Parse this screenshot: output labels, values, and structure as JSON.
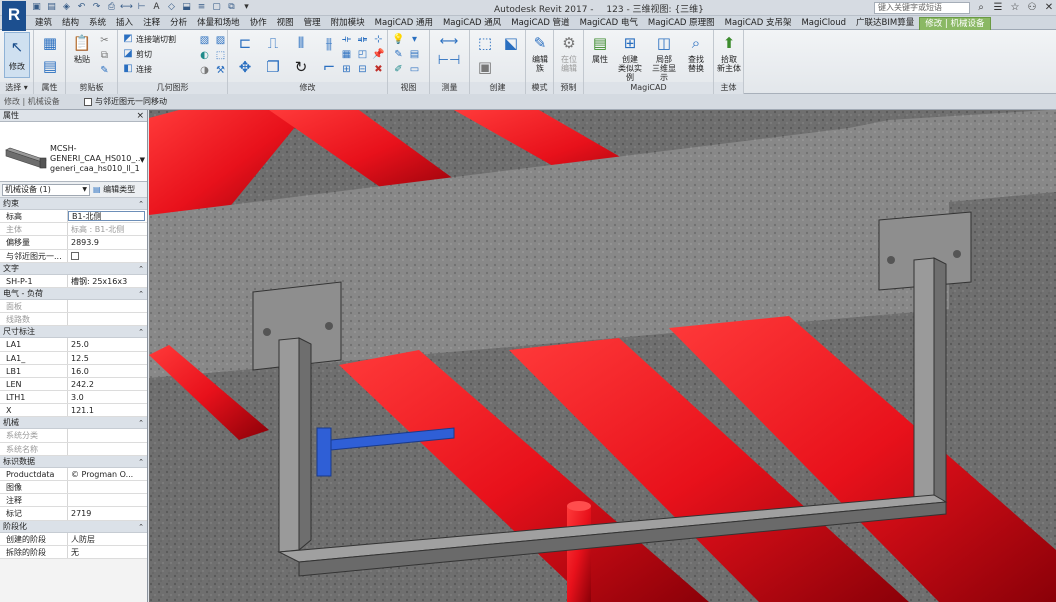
{
  "titlebar": {
    "app_name": "Autodesk Revit 2017 -",
    "document": "123 - 三维视图: {三维}",
    "search_placeholder": "键入关键字或短语"
  },
  "tabs": [
    "建筑",
    "结构",
    "系统",
    "插入",
    "注释",
    "分析",
    "体量和场地",
    "协作",
    "视图",
    "管理",
    "附加模块",
    "MagiCAD 通用",
    "MagiCAD 通风",
    "MagiCAD 管道",
    "MagiCAD 电气",
    "MagiCAD 原理图",
    "MagiCAD 支吊架",
    "MagiCloud",
    "广联达BIM算量",
    "修改 | 机械设备"
  ],
  "active_tab_index": 19,
  "ribbon": {
    "modify_label": "修改",
    "clipboard": {
      "paste": "粘贴"
    },
    "geometry": {
      "cut": "连接端切割",
      "cut2": "剪切",
      "join": "连接"
    },
    "big_buttons": [
      {
        "label": "编辑\n族",
        "name": "edit-family"
      },
      {
        "label": "在位\n编辑",
        "name": "edit-in-place"
      },
      {
        "label": "属性",
        "name": "magicad-properties"
      },
      {
        "label": "创建\n类似实例",
        "name": "create-similar"
      },
      {
        "label": "局部\n三维显示",
        "name": "local-3d"
      },
      {
        "label": "查找\n替换",
        "name": "find-replace"
      },
      {
        "label": "拾取\n新主体",
        "name": "pick-new-host"
      }
    ],
    "panel_labels": {
      "select": "选择 ▾",
      "properties": "属性",
      "clipboard": "剪贴板",
      "geometry": "几何图形",
      "modify": "修改",
      "view": "视图",
      "measure": "测量",
      "create": "创建",
      "mode": "模式",
      "preset": "预制",
      "magicad": "MagiCAD",
      "host": "主体"
    }
  },
  "options_bar": {
    "label": "修改 | 机械设备",
    "checkbox_label": "与邻近图元一同移动"
  },
  "properties_palette": {
    "title": "属性",
    "type_name_line1": "MCSH-",
    "type_name_line2": "GENERI_CAA_HS010_...",
    "type_name_line3": "generi_caa_hs010_ll_1",
    "instance_selector": "机械设备 (1)",
    "edit_type": "编辑类型",
    "sections": [
      {
        "title": "约束",
        "rows": [
          {
            "name": "标高",
            "value": "B1-北侧",
            "boxed": true
          },
          {
            "name": "主体",
            "value": "标高 : B1-北侧",
            "dim": true
          },
          {
            "name": "偏移量",
            "value": "2893.9"
          },
          {
            "name": "与邻近图元一...",
            "value": "",
            "checkbox": true
          }
        ]
      },
      {
        "title": "文字",
        "rows": [
          {
            "name": "SH-P-1",
            "value": "槽钢: 25x16x3"
          }
        ]
      },
      {
        "title": "电气 - 负荷",
        "rows": [
          {
            "name": "面板",
            "value": "",
            "dim": true
          },
          {
            "name": "线路数",
            "value": "",
            "dim": true
          }
        ]
      },
      {
        "title": "尺寸标注",
        "rows": [
          {
            "name": "LA1",
            "value": "25.0"
          },
          {
            "name": "LA1_",
            "value": "12.5"
          },
          {
            "name": "LB1",
            "value": "16.0"
          },
          {
            "name": "LEN",
            "value": "242.2"
          },
          {
            "name": "LTH1",
            "value": "3.0"
          },
          {
            "name": "X",
            "value": "121.1"
          }
        ]
      },
      {
        "title": "机械",
        "rows": [
          {
            "name": "系统分类",
            "value": "",
            "dim": true
          },
          {
            "name": "系统名称",
            "value": "",
            "dim": true
          }
        ]
      },
      {
        "title": "标识数据",
        "rows": [
          {
            "name": "Productdata",
            "value": "© Progman O..."
          },
          {
            "name": "图像",
            "value": ""
          },
          {
            "name": "注释",
            "value": ""
          },
          {
            "name": "标记",
            "value": "2719"
          }
        ]
      },
      {
        "title": "阶段化",
        "rows": [
          {
            "name": "创建的阶段",
            "value": "人防层"
          },
          {
            "name": "拆除的阶段",
            "value": "无"
          }
        ]
      }
    ]
  },
  "colors": {
    "pipe_red": "#e8111b",
    "concrete": "#6e6e6e",
    "steel_channel": "#8c8c8c",
    "accent_tab": "#8ab864",
    "selection_blue": "#2f5fd6"
  }
}
